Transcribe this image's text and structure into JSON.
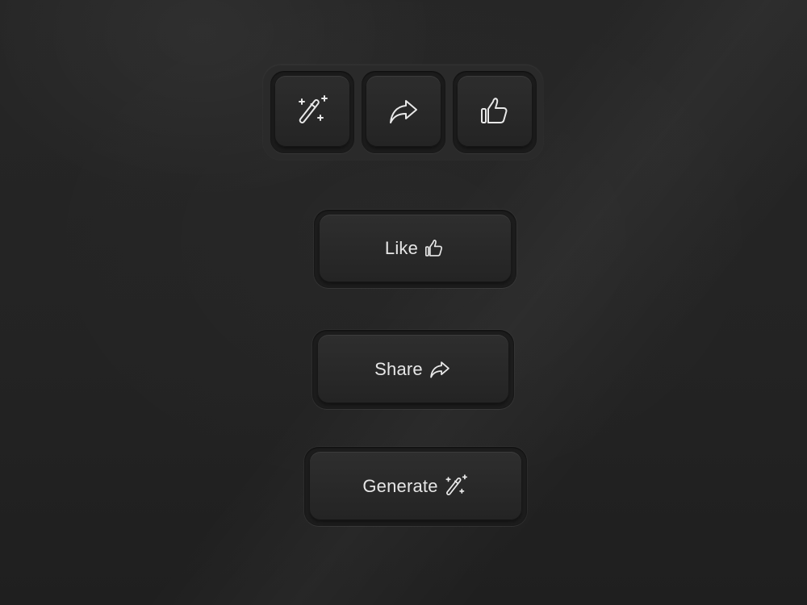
{
  "icon_buttons": [
    {
      "icon": "magic-wand-icon"
    },
    {
      "icon": "share-arrow-icon"
    },
    {
      "icon": "thumbs-up-icon"
    }
  ],
  "buttons": {
    "like": {
      "label": "Like",
      "icon": "thumbs-up-icon"
    },
    "share": {
      "label": "Share",
      "icon": "share-arrow-icon"
    },
    "generate": {
      "label": "Generate",
      "icon": "magic-wand-icon"
    }
  },
  "colors": {
    "background": "#242424",
    "button_face": "#2a2a2a",
    "text": "#e6e6e6"
  }
}
